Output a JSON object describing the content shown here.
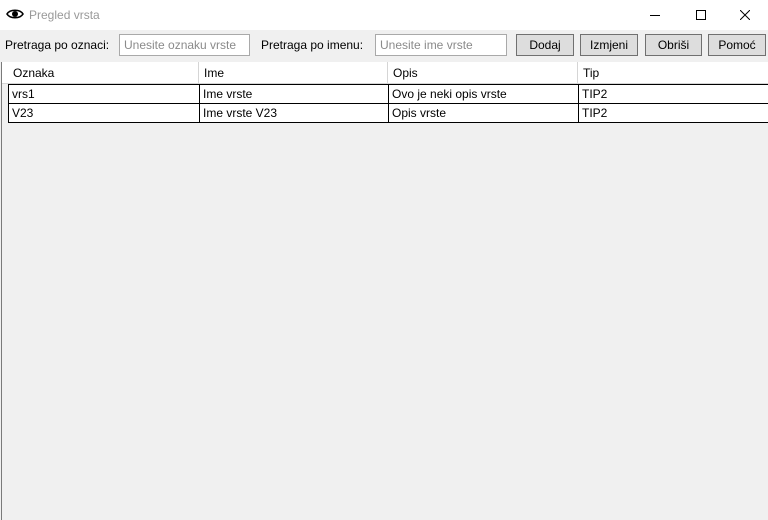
{
  "window": {
    "title": "Pregled vrsta",
    "icon": "eye-icon"
  },
  "toolbar": {
    "search_oznaka_label": "Pretraga po oznaci:",
    "search_oznaka_placeholder": "Unesite oznaku vrste",
    "search_oznaka_value": "",
    "search_ime_label": "Pretraga po imenu:",
    "search_ime_placeholder": "Unesite ime vrste",
    "search_ime_value": "",
    "buttons": {
      "dodaj": "Dodaj",
      "izmjeni": "Izmjeni",
      "obrisi": "Obriši",
      "pomoc": "Pomoć"
    }
  },
  "grid": {
    "columns": [
      "Oznaka",
      "Ime",
      "Opis",
      "Tip"
    ],
    "rows": [
      [
        "vrs1",
        "Ime vrste",
        "Ovo je neki opis vrste",
        "TIP2"
      ],
      [
        "V23",
        "Ime vrste V23",
        "Opis vrste",
        "TIP2"
      ]
    ]
  }
}
